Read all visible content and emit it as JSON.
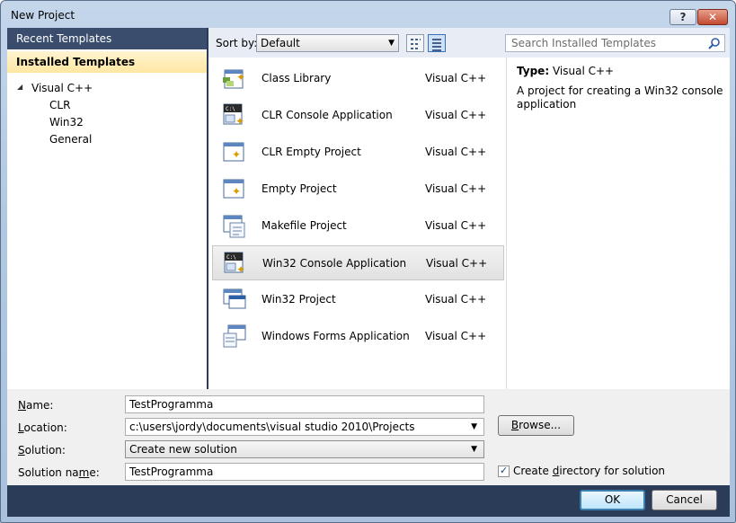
{
  "window": {
    "title": "New Project",
    "help": "?",
    "close": "✕"
  },
  "left": {
    "recent": "Recent Templates",
    "installed": "Installed Templates",
    "tree": {
      "root": "Visual C++",
      "children": [
        "CLR",
        "Win32",
        "General"
      ]
    }
  },
  "toolbar": {
    "sort_label": "Sort by:",
    "sort_value": "Default",
    "search_placeholder": "Search Installed Templates"
  },
  "templates": [
    {
      "name": "Class Library",
      "lang": "Visual C++",
      "icon": "class-library-icon"
    },
    {
      "name": "CLR Console Application",
      "lang": "Visual C++",
      "icon": "console-app-icon"
    },
    {
      "name": "CLR Empty Project",
      "lang": "Visual C++",
      "icon": "empty-project-icon"
    },
    {
      "name": "Empty Project",
      "lang": "Visual C++",
      "icon": "empty-project-icon"
    },
    {
      "name": "Makefile Project",
      "lang": "Visual C++",
      "icon": "makefile-project-icon"
    },
    {
      "name": "Win32 Console Application",
      "lang": "Visual C++",
      "icon": "console-app-icon",
      "selected": true
    },
    {
      "name": "Win32 Project",
      "lang": "Visual C++",
      "icon": "win32-project-icon"
    },
    {
      "name": "Windows Forms Application",
      "lang": "Visual C++",
      "icon": "windows-forms-icon"
    }
  ],
  "description": {
    "type_label": "Type:",
    "type_value": "Visual C++",
    "text": "A project for creating a Win32 console application"
  },
  "form": {
    "name_label": "Name:",
    "name_value": "TestProgramma",
    "location_label": "Location:",
    "location_value": "c:\\users\\jordy\\documents\\visual studio 2010\\Projects",
    "browse": "Browse...",
    "solution_label": "Solution:",
    "solution_value": "Create new solution",
    "solution_name_label": "Solution name:",
    "solution_name_value": "TestProgramma",
    "create_dir_label": "Create directory for solution",
    "create_dir_checked": true
  },
  "buttons": {
    "ok": "OK",
    "cancel": "Cancel"
  },
  "colors": {
    "selection_header": "#3a4d6d",
    "installed_highlight": "#ffe6a3",
    "frame": "#2b3c59"
  }
}
